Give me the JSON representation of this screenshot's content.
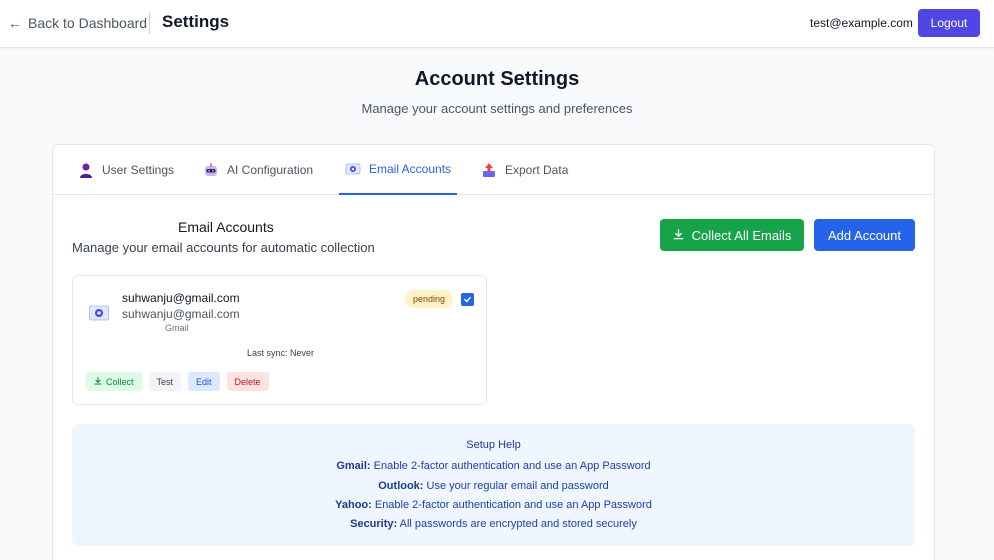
{
  "header": {
    "back_label": "Back to Dashboard",
    "title": "Settings",
    "user_email": "test@example.com",
    "logout_label": "Logout"
  },
  "page": {
    "title": "Account Settings",
    "subtitle": "Manage your account settings and preferences"
  },
  "tabs": [
    {
      "label": "User Settings",
      "icon": "user-icon"
    },
    {
      "label": "AI Configuration",
      "icon": "robot-icon"
    },
    {
      "label": "Email Accounts",
      "icon": "email-icon",
      "active": true
    },
    {
      "label": "Export Data",
      "icon": "export-icon"
    }
  ],
  "email_section": {
    "title": "Email Accounts",
    "description": "Manage your email accounts for automatic collection",
    "collect_all_label": "Collect All Emails",
    "add_account_label": "Add Account"
  },
  "accounts": [
    {
      "email": "suhwanju@gmail.com",
      "display_email": "suhwanju@gmail.com",
      "provider": "Gmail",
      "status": "pending",
      "selected": true,
      "last_sync": "Last sync: Never",
      "actions": {
        "collect": "Collect",
        "test": "Test",
        "edit": "Edit",
        "delete": "Delete"
      }
    }
  ],
  "help": {
    "title": "Setup Help",
    "lines": [
      {
        "label": "Gmail:",
        "text": " Enable 2-factor authentication and use an App Password"
      },
      {
        "label": "Outlook:",
        "text": " Use your regular email and password"
      },
      {
        "label": "Yahoo:",
        "text": " Enable 2-factor authentication and use an App Password"
      },
      {
        "label": "Security:",
        "text": " All passwords are encrypted and stored securely"
      }
    ]
  },
  "colors": {
    "primary": "#4f46e5",
    "blue": "#2563eb",
    "green": "#16a34a",
    "pending_bg": "#fef3c7",
    "help_bg": "#eff6ff"
  }
}
